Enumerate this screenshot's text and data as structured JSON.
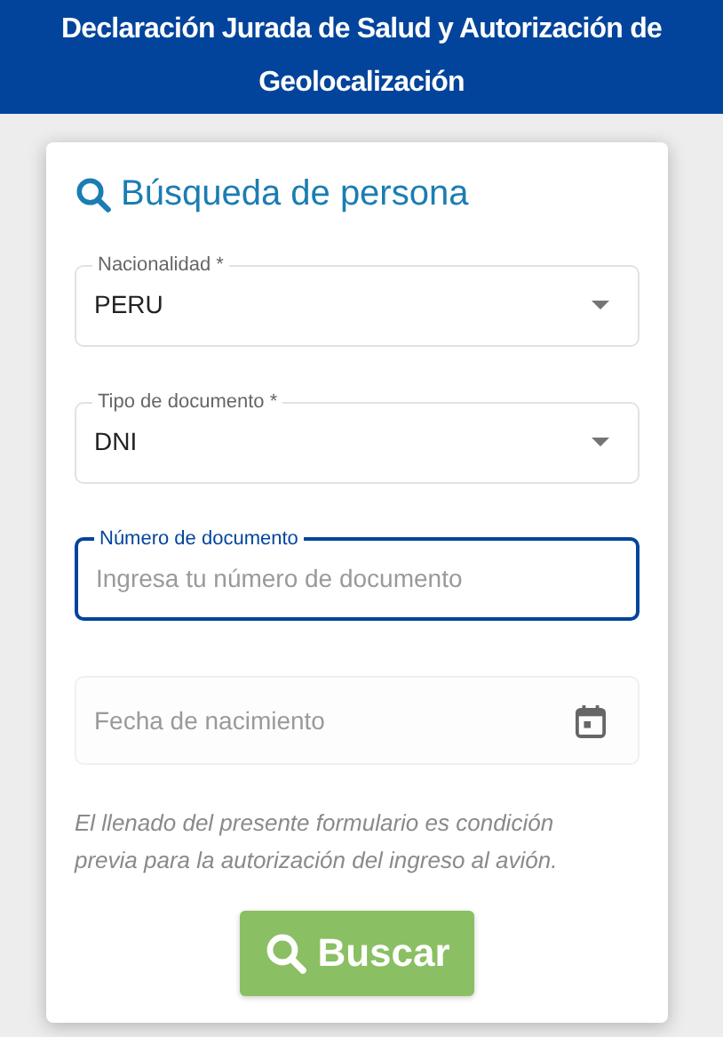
{
  "header": {
    "title": "Declaración Jurada de Salud y Autorización de Geolocalización"
  },
  "card": {
    "title": "Búsqueda de persona",
    "fields": [
      {
        "kind": "select",
        "label": "Nacionalidad *",
        "value": "PERU",
        "focused": false
      },
      {
        "kind": "select",
        "label": "Tipo de documento *",
        "value": "DNI",
        "focused": false
      },
      {
        "kind": "text",
        "label": "Número de documento",
        "placeholder": "Ingresa tu número de documento",
        "focused": true
      },
      {
        "kind": "date",
        "placeholder": "Fecha de nacimiento",
        "focused": false
      }
    ],
    "note": "El llenado del presente formulario es condición previa para la autorización del ingreso al avión.",
    "button": "Buscar"
  }
}
